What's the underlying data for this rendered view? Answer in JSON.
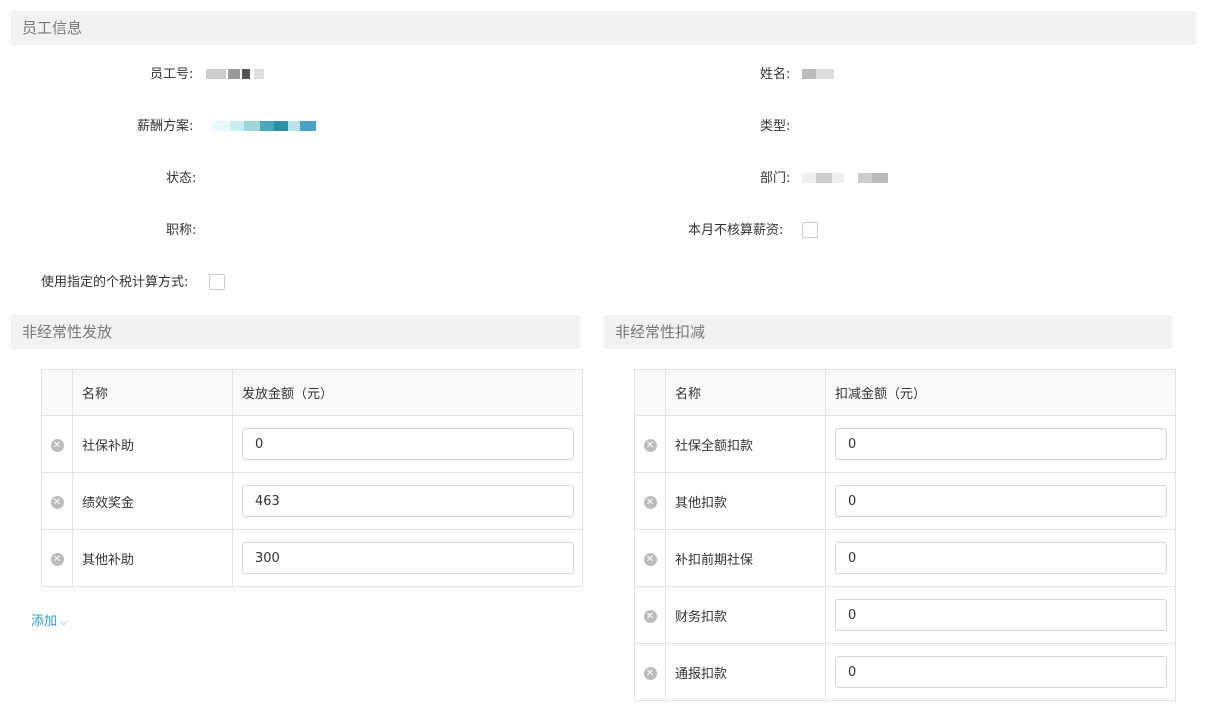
{
  "info": {
    "title": "员工信息",
    "employee_no_label": "员工号:",
    "employee_no_value": "",
    "name_label": "姓名:",
    "name_value": "",
    "salary_plan_label": "薪酬方案:",
    "type_label": "类型:",
    "status_label": "状态:",
    "dept_label": "部门:",
    "title_label": "职称:",
    "no_salary_label": "本月不核算薪资:",
    "tax_method_label": "使用指定的个税计算方式:"
  },
  "payments": {
    "title": "非经常性发放",
    "col_name": "名称",
    "col_amount": "发放金额（元）",
    "rows": [
      {
        "name": "社保补助",
        "amount": "0"
      },
      {
        "name": "绩效奖金",
        "amount": "463"
      },
      {
        "name": "其他补助",
        "amount": "300"
      }
    ],
    "add_label": "添加"
  },
  "deductions": {
    "title": "非经常性扣减",
    "col_name": "名称",
    "col_amount": "扣减金额（元）",
    "rows": [
      {
        "name": "社保全额扣款",
        "amount": "0"
      },
      {
        "name": "其他扣款",
        "amount": "0"
      },
      {
        "name": "补扣前期社保",
        "amount": "0"
      },
      {
        "name": "财务扣款",
        "amount": "0"
      },
      {
        "name": "通报扣款",
        "amount": "0"
      }
    ]
  },
  "icons": {
    "delete": "circle-x-icon",
    "chevron": "chevron-down-icon"
  },
  "colors": {
    "link": "#2a9dd6",
    "header_bg": "#f2f2f2"
  }
}
